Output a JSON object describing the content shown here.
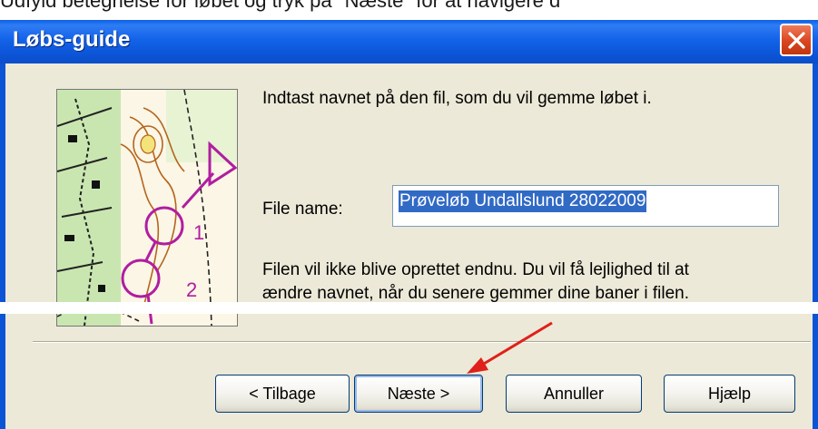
{
  "document_caption": "Udfyld betegnelse for løbet og tryk på \"Næste\" for at navigere d",
  "window": {
    "title": "Løbs-guide"
  },
  "content": {
    "prompt": "Indtast navnet på den fil, som du vil gemme løbet i.",
    "file_name_label": "File name:",
    "file_name_value": "Prøveløb Undallslund 28022009",
    "note_line1": "Filen vil ikke blive oprettet endnu.  Du vil få lejlighed til at",
    "note_line2": "ændre navnet, når du senere gemmer dine baner i filen."
  },
  "map_labels": {
    "control_1": "1",
    "control_2": "2"
  },
  "buttons": {
    "back": "< Tilbage",
    "next": "Næste >",
    "cancel": "Annuller",
    "help": "Hjælp"
  },
  "colors": {
    "titlebar": "#0c54d6",
    "dialog_bg": "#ece9d8",
    "selection": "#316ac5",
    "course_overprint": "#b01ea0",
    "arrow": "#e0201a"
  },
  "icons": {
    "close": "close-icon",
    "annotation": "red-arrow-icon"
  }
}
